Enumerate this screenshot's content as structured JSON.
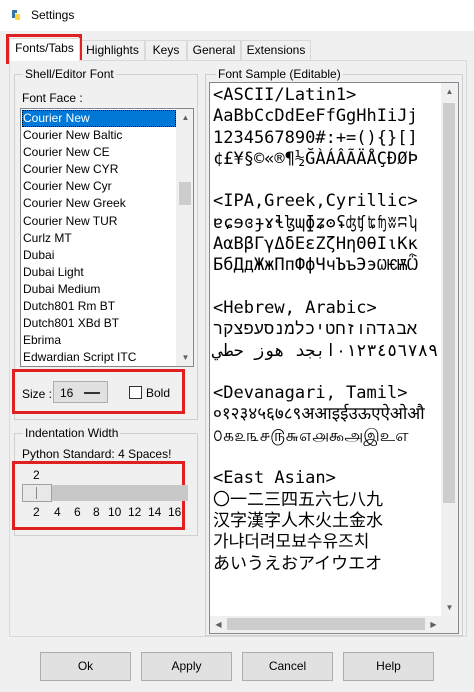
{
  "window": {
    "title": "Settings",
    "app_icon": "python-idle-icon",
    "highlight_color": "#e02020"
  },
  "tabs": [
    {
      "label": "Fonts/Tabs",
      "active": true
    },
    {
      "label": "Highlights",
      "active": false
    },
    {
      "label": "Keys",
      "active": false
    },
    {
      "label": "General",
      "active": false
    },
    {
      "label": "Extensions",
      "active": false
    }
  ],
  "shell_editor_font": {
    "group_label": "Shell/Editor Font",
    "font_face_label": "Font Face :",
    "font_list": [
      "Courier New",
      "Courier New Baltic",
      "Courier New CE",
      "Courier New CYR",
      "Courier New Cyr",
      "Courier New Greek",
      "Courier New TUR",
      "Curlz MT",
      "Dubai",
      "Dubai Light",
      "Dubai Medium",
      "Dutch801 Rm BT",
      "Dutch801 XBd BT",
      "Ebrima",
      "Edwardian Script ITC"
    ],
    "selected_font": "Courier New",
    "size_label": "Size :",
    "size_value": "16",
    "bold_label": "Bold",
    "bold_checked": false
  },
  "indentation": {
    "group_label": "Indentation Width",
    "hint": "Python Standard: 4 Spaces!",
    "current_value": "2",
    "ticks": [
      "2",
      "4",
      "6",
      "8",
      "10",
      "12",
      "14",
      "16"
    ]
  },
  "font_sample": {
    "group_label": "Font Sample (Editable)",
    "lines": [
      "<ASCII/Latin1>",
      "AaBbCcDdEeFfGgHhIiJj",
      "1234567890#:+=(){}[]",
      "¢£¥§©«®¶½ĞÀÁÂÃÄÅÇÐØÞ",
      "",
      "<IPA,Greek,Cyrillic>",
      "ɐɕɘɞɟɤɬɮɰɸʑʘʢʤʧʨʩʬʭʮ",
      "ΑαΒβΓγΔδΕεΖζΗηΘθΙιΚκ",
      "БбДдЖжПпФфЧчЪъЭэѠѤѬѼ",
      "",
      "<Hebrew, Arabic>",
      "אבגדהוזחטיכלמנסעפצקר",
      "٠١٢٣٤٥٦٧٨٩ابجد هوز حطي",
      "",
      "<Devanagari, Tamil>",
      "०१२३४५६७८९अआइईउऊएऐओऔ",
      "௦௧௨௩௪௫௬௭௮௯அஇஉஎ",
      "",
      "<East Asian>",
      "〇一二三四五六七八九",
      "汉字漢字人木火土金水",
      "가냐더려모뵤수유즈치",
      "あいうえおアイウエオ"
    ]
  },
  "buttons": {
    "ok": "Ok",
    "apply": "Apply",
    "cancel": "Cancel",
    "help": "Help"
  }
}
